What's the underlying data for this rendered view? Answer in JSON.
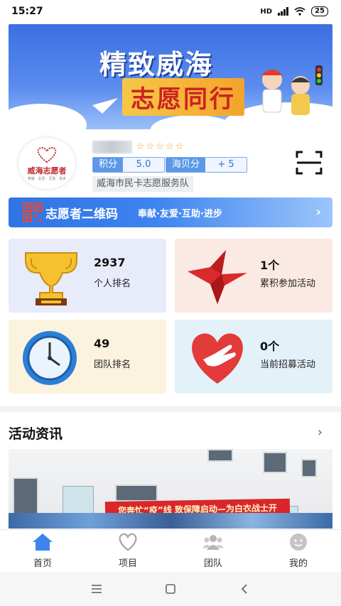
{
  "status_bar": {
    "time": "15:27",
    "network": "HD",
    "battery": "25"
  },
  "banner": {
    "line1": "精致威海",
    "line2": "志愿同行"
  },
  "profile": {
    "avatar_text": "威海志愿者",
    "avatar_subtext": "奉献 · 友爱 · 互助 · 进步",
    "stars": "☆☆☆☆☆",
    "points_label": "积分",
    "points_value": "5.0",
    "haibei_label": "海贝分",
    "haibei_value": "+ 5",
    "team": "威海市民卡志愿服务队"
  },
  "qr_banner": {
    "title": "志愿者二维码",
    "slogan": "奉献·友爱·互助·进步",
    "arrow": "›"
  },
  "stats": [
    {
      "value": "2937",
      "label": "个人排名",
      "icon": "trophy-icon"
    },
    {
      "value": "1个",
      "label": "累积参加活动",
      "icon": "origami-bird-icon"
    },
    {
      "value": "49",
      "label": "团队排名",
      "icon": "clock-icon"
    },
    {
      "value": "0个",
      "label": "当前招募活动",
      "icon": "heart-hand-icon"
    }
  ],
  "news": {
    "title": "活动资讯",
    "more": "›",
    "image_banner_text": "您奔忙“疫”线 致保障启动—为白衣战士开展“心”服务"
  },
  "tabs": [
    {
      "label": "首页",
      "icon": "home-icon",
      "active": true
    },
    {
      "label": "项目",
      "icon": "heart-icon",
      "active": false
    },
    {
      "label": "团队",
      "icon": "group-icon",
      "active": false
    },
    {
      "label": "我的",
      "icon": "profile-icon",
      "active": false
    }
  ],
  "colors": {
    "accent": "#3d84ef",
    "brand_red": "#c0282d"
  }
}
